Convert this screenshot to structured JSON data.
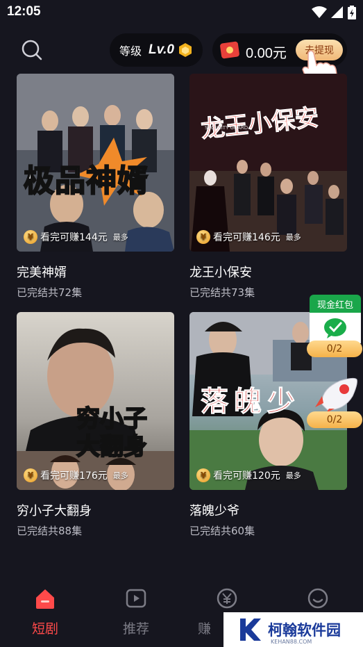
{
  "status_bar": {
    "time": "12:05"
  },
  "header": {
    "level_label": "等级",
    "level_value": "Lv.0",
    "wallet_amount": "0.00元",
    "withdraw_label": "去提现"
  },
  "dramas": [
    {
      "poster_text": "极品神婿",
      "earn": "看完可赚144元",
      "earn_max": "最多",
      "name": "完美神婿",
      "episodes": "已完结共72集"
    },
    {
      "poster_text": "龙王小保安",
      "poster_sub": "SECURITY GUARD",
      "earn": "看完可赚146元",
      "earn_max": "最多",
      "name": "龙王小保安",
      "episodes": "已完结共73集"
    },
    {
      "poster_text": "穷小子大翻身",
      "earn": "看完可赚176元",
      "earn_max": "最多",
      "name": "穷小子大翻身",
      "episodes": "已完结共88集"
    },
    {
      "poster_text": "落魄少",
      "earn": "看完可赚120元",
      "earn_max": "最多",
      "name": "落魄少爷",
      "episodes": "已完结共60集"
    }
  ],
  "widgets": {
    "redpacket_title": "现金红包",
    "redpacket_progress": "0/2",
    "rocket_progress": "0/2"
  },
  "nav": [
    {
      "label": "短剧",
      "icon": "home-icon",
      "active": true
    },
    {
      "label": "推荐",
      "icon": "play-icon",
      "active": false
    },
    {
      "label": "赚",
      "icon": "yuan-icon",
      "active": false
    },
    {
      "label": "",
      "icon": "smile-icon",
      "active": false
    }
  ],
  "watermark": {
    "text": "柯翰软件园",
    "sub": "KEHAN88.COM"
  },
  "colors": {
    "accent": "#ff4a4a",
    "background": "#16161f",
    "pill": "#0d0d12"
  }
}
